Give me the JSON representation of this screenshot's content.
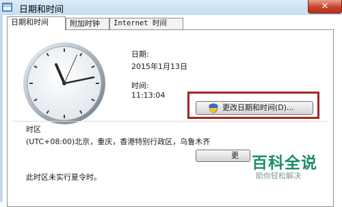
{
  "window": {
    "title": "日期和时间",
    "close_symbol": "✕"
  },
  "tabs": [
    {
      "label": "日期和时间",
      "active": true
    },
    {
      "label": "附加时钟",
      "active": false
    },
    {
      "label": "Internet 时间",
      "active": false
    }
  ],
  "clock": {
    "hour": 11,
    "minute": 13,
    "second": 4
  },
  "date": {
    "label": "日期:",
    "value": "2015年1月13日"
  },
  "time": {
    "label": "时间:",
    "value": "11:13:04"
  },
  "change_datetime_button": {
    "label": "更改日期和时间(D)..."
  },
  "timezone": {
    "label": "时区",
    "value": "(UTC+08:00)北京，重庆，香港特别行政区，乌鲁木齐",
    "change_button_label": "更"
  },
  "dst_note": "此时区未实行夏令时。",
  "watermark": {
    "title": "百科全说",
    "subtitle": "助你轻松解决"
  },
  "colors": {
    "highlight": "#a02520",
    "titlebar": "#c6dcf1",
    "watermark": "#1c8c6c"
  }
}
